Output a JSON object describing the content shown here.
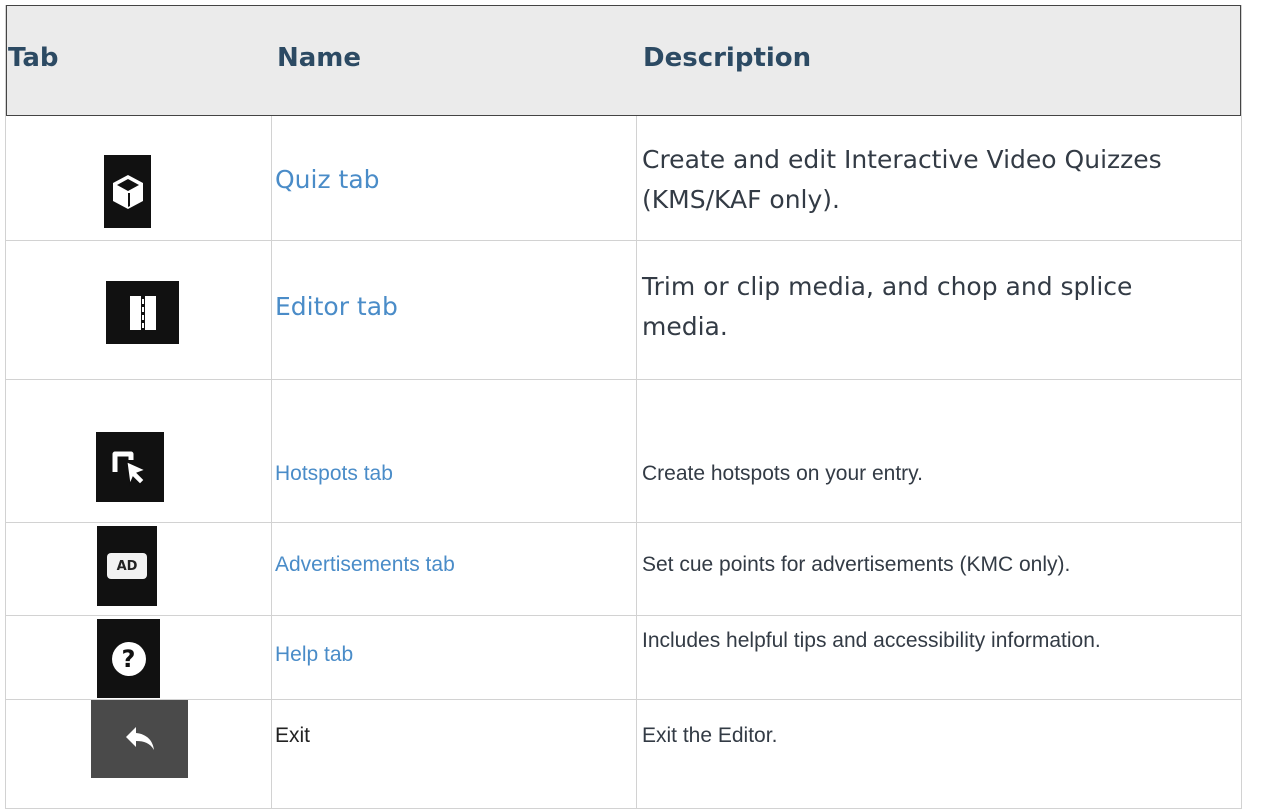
{
  "table": {
    "headers": {
      "tab": "Tab",
      "name": "Name",
      "description": "Description"
    },
    "rows": [
      {
        "icon": "cube-icon",
        "name": "Quiz tab",
        "description": "Create and edit Interactive Video Quizzes (KMS/KAF only)."
      },
      {
        "icon": "editor-split-icon",
        "name": "Editor tab",
        "description": "Trim or clip media, and chop and splice media."
      },
      {
        "icon": "hotspot-cursor-icon",
        "name": "Hotspots tab",
        "description": "Create hotspots on your entry."
      },
      {
        "icon": "ad-icon",
        "icon_text": "AD",
        "name": "Advertisements tab",
        "description": "Set cue points for advertisements (KMC only)."
      },
      {
        "icon": "help-icon",
        "icon_text": "?",
        "name": "Help tab",
        "description": "Includes helpful tips and accessibility information."
      },
      {
        "icon": "exit-arrow-icon",
        "name": "Exit",
        "description": "Exit the Editor."
      }
    ]
  },
  "colors": {
    "header_bg": "#ebebeb",
    "header_text": "#2c4a63",
    "link": "#4a8cc8",
    "icon_bg": "#111111",
    "exit_icon_bg": "#4a4a4a"
  }
}
